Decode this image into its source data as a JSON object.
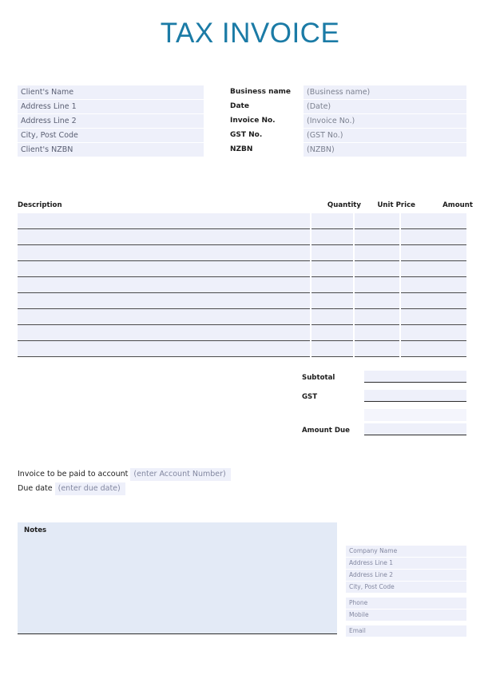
{
  "document": {
    "title": "TAX INVOICE",
    "accent_color": "#1b7ba6",
    "field_fill_color": "#eef0fa",
    "notes_fill_color": "#e3eaf6"
  },
  "client": {
    "fields": [
      "Client's Name",
      "Address Line 1",
      "Address Line 2",
      "City, Post Code",
      "Client's NZBN"
    ]
  },
  "business": {
    "rows": [
      {
        "label": "Business name",
        "value": "(Business name)"
      },
      {
        "label": "Date",
        "value": "(Date)"
      },
      {
        "label": "Invoice No.",
        "value": "(Invoice No.)"
      },
      {
        "label": "GST No.",
        "value": "(GST No.)"
      },
      {
        "label": "NZBN",
        "value": "(NZBN)"
      }
    ]
  },
  "items_table": {
    "headers": {
      "description": "Description",
      "quantity": "Quantity",
      "unit_price": "Unit Price",
      "amount": "Amount"
    },
    "row_count": 9,
    "rows": [
      {
        "description": "",
        "quantity": "",
        "unit_price": "",
        "amount": ""
      },
      {
        "description": "",
        "quantity": "",
        "unit_price": "",
        "amount": ""
      },
      {
        "description": "",
        "quantity": "",
        "unit_price": "",
        "amount": ""
      },
      {
        "description": "",
        "quantity": "",
        "unit_price": "",
        "amount": ""
      },
      {
        "description": "",
        "quantity": "",
        "unit_price": "",
        "amount": ""
      },
      {
        "description": "",
        "quantity": "",
        "unit_price": "",
        "amount": ""
      },
      {
        "description": "",
        "quantity": "",
        "unit_price": "",
        "amount": ""
      },
      {
        "description": "",
        "quantity": "",
        "unit_price": "",
        "amount": ""
      },
      {
        "description": "",
        "quantity": "",
        "unit_price": "",
        "amount": ""
      }
    ]
  },
  "totals": {
    "subtotal_label": "Subtotal",
    "subtotal_value": "",
    "gst_label": "GST",
    "gst_value": "",
    "amount_due_label": "Amount Due",
    "amount_due_value": ""
  },
  "payment": {
    "account_label": "Invoice to be paid to account",
    "account_value": "(enter Account Number)",
    "due_date_label": "Due date",
    "due_date_value": "(enter due date)"
  },
  "notes": {
    "label": "Notes",
    "value": ""
  },
  "company": {
    "fields": [
      "Company Name",
      "Address Line 1",
      "Address Line 2",
      "City, Post Code"
    ],
    "contact": [
      "Phone",
      "Mobile"
    ],
    "email": "Email"
  }
}
